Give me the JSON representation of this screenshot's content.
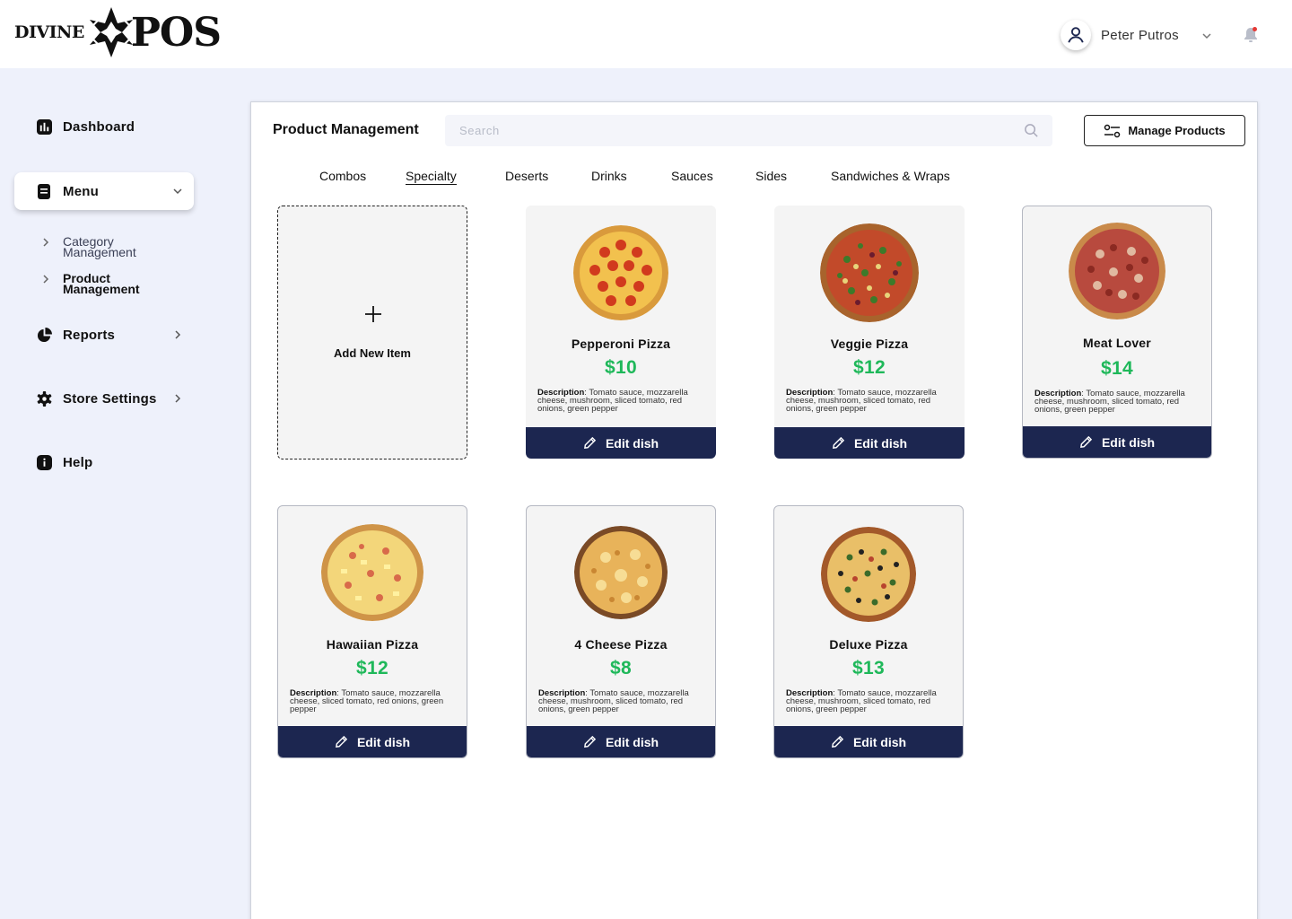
{
  "brand": {
    "word1": "DIVINE",
    "word2": "POS"
  },
  "user": {
    "name": "Peter Putros",
    "avatar_icon": "user-icon",
    "notification_icon": "bell-icon"
  },
  "sidebar": {
    "dashboard": "Dashboard",
    "menu": "Menu",
    "submenu": [
      {
        "label": "Category Management",
        "active": false
      },
      {
        "label": "Product Management",
        "active": true
      }
    ],
    "reports": "Reports",
    "store_settings": "Store Settings",
    "help": "Help"
  },
  "panel": {
    "title": "Product Management",
    "search_placeholder": "Search",
    "manage_label": "Manage Products"
  },
  "tabs": [
    {
      "label": "Combos",
      "active": false
    },
    {
      "label": "Specialty",
      "active": true
    },
    {
      "label": "Deserts",
      "active": false
    },
    {
      "label": "Drinks",
      "active": false
    },
    {
      "label": "Sauces",
      "active": false
    },
    {
      "label": "Sides",
      "active": false
    },
    {
      "label": "Sandwiches & Wraps",
      "active": false
    }
  ],
  "add_item_label": "Add New Item",
  "edit_label": "Edit dish",
  "desc_label": "Description",
  "products": [
    {
      "name": "Pepperoni Pizza",
      "price": "$10",
      "desc": ": Tomato sauce, mozzarella cheese, mushroom, sliced tomato, red onions, green pepper"
    },
    {
      "name": "Veggie Pizza",
      "price": "$12",
      "desc": ": Tomato sauce, mozzarella cheese, mushroom, sliced tomato, red onions, green pepper"
    },
    {
      "name": "Meat Lover",
      "price": "$14",
      "desc": ": Tomato sauce, mozzarella cheese, mushroom, sliced tomato, red onions, green pepper"
    },
    {
      "name": "Hawaiian Pizza",
      "price": "$12",
      "desc": ": Tomato sauce, mozzarella cheese, sliced tomato, red onions, green pepper"
    },
    {
      "name": "4 Cheese Pizza",
      "price": "$8",
      "desc": ": Tomato sauce, mozzarella cheese, mushroom, sliced tomato, red onions, green pepper"
    },
    {
      "name": "Deluxe Pizza",
      "price": "$13",
      "desc": ": Tomato sauce, mozzarella cheese, mushroom, sliced tomato, red onions, green pepper"
    }
  ],
  "colors": {
    "accent": "#1c2650",
    "price": "#1fb85a",
    "background": "#eef1fb"
  }
}
